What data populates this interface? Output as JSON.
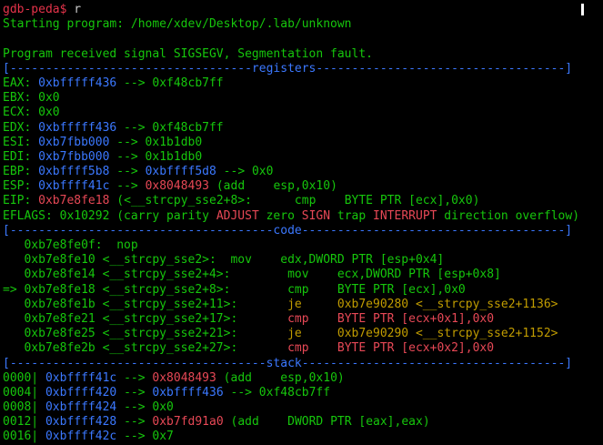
{
  "colors": {
    "default": "#cccccc",
    "prompt": "#e5334a",
    "green": "#16c60c",
    "blue": "#3b78ff",
    "red": "#e74856",
    "yellow": "#c19c00"
  },
  "terminal": {
    "lines": [
      {
        "name": "prompt-line",
        "segments": [
          {
            "text": "gdb-peda$ ",
            "color": "prompt"
          },
          {
            "text": "r",
            "color": "default"
          }
        ]
      },
      {
        "name": "output-line",
        "segments": [
          {
            "text": "Starting program: /home/xdev/Desktop/.lab/unknown",
            "color": "green"
          }
        ]
      },
      {
        "name": "blank-line",
        "segments": []
      },
      {
        "name": "output-line",
        "segments": [
          {
            "text": "Program received signal SIGSEGV, Segmentation fault.",
            "color": "green"
          }
        ]
      },
      {
        "name": "section-header-registers",
        "segments": [
          {
            "text": "[----------------------------------registers-----------------------------------]",
            "color": "blue"
          }
        ]
      },
      {
        "name": "register-eax",
        "segments": [
          {
            "text": "EAX: ",
            "color": "green"
          },
          {
            "text": "0xbfffff436",
            "color": "blue"
          },
          {
            "text": " --> 0xf48cb7ff",
            "color": "green"
          }
        ]
      },
      {
        "name": "register-ebx",
        "segments": [
          {
            "text": "EBX: 0x0",
            "color": "green"
          }
        ]
      },
      {
        "name": "register-ecx",
        "segments": [
          {
            "text": "ECX: 0x0",
            "color": "green"
          }
        ]
      },
      {
        "name": "register-edx",
        "segments": [
          {
            "text": "EDX: ",
            "color": "green"
          },
          {
            "text": "0xbfffff436",
            "color": "blue"
          },
          {
            "text": " --> 0xf48cb7ff",
            "color": "green"
          }
        ]
      },
      {
        "name": "register-esi",
        "segments": [
          {
            "text": "ESI: ",
            "color": "green"
          },
          {
            "text": "0xb7fbb000",
            "color": "blue"
          },
          {
            "text": " --> 0x1b1db0",
            "color": "green"
          }
        ]
      },
      {
        "name": "register-edi",
        "segments": [
          {
            "text": "EDI: ",
            "color": "green"
          },
          {
            "text": "0xb7fbb000",
            "color": "blue"
          },
          {
            "text": " --> 0x1b1db0",
            "color": "green"
          }
        ]
      },
      {
        "name": "register-ebp",
        "segments": [
          {
            "text": "EBP: ",
            "color": "green"
          },
          {
            "text": "0xbffff5b8",
            "color": "blue"
          },
          {
            "text": " --> ",
            "color": "green"
          },
          {
            "text": "0xbffff5d8",
            "color": "blue"
          },
          {
            "text": " --> 0x0",
            "color": "green"
          }
        ]
      },
      {
        "name": "register-esp",
        "segments": [
          {
            "text": "ESP: ",
            "color": "green"
          },
          {
            "text": "0xbffff41c",
            "color": "blue"
          },
          {
            "text": " --> ",
            "color": "green"
          },
          {
            "text": "0x8048493",
            "color": "red"
          },
          {
            "text": " (add    esp,0x10)",
            "color": "green"
          }
        ]
      },
      {
        "name": "register-eip",
        "segments": [
          {
            "text": "EIP: ",
            "color": "green"
          },
          {
            "text": "0xb7e8fe18",
            "color": "red"
          },
          {
            "text": " (<__strcpy_sse2+8>:      cmp    BYTE PTR [ecx],0x0)",
            "color": "green"
          }
        ]
      },
      {
        "name": "register-eflags",
        "segments": [
          {
            "text": "EFLAGS: 0x10292 (carry parity ",
            "color": "green"
          },
          {
            "text": "ADJUST",
            "color": "red"
          },
          {
            "text": " zero ",
            "color": "green"
          },
          {
            "text": "SIGN",
            "color": "red"
          },
          {
            "text": " trap ",
            "color": "green"
          },
          {
            "text": "INTERRUPT",
            "color": "red"
          },
          {
            "text": " direction overflow)",
            "color": "green"
          }
        ]
      },
      {
        "name": "section-header-code",
        "segments": [
          {
            "text": "[-------------------------------------code-------------------------------------]",
            "color": "blue"
          }
        ]
      },
      {
        "name": "code-line",
        "segments": [
          {
            "text": "   0xb7e8fe0f:  nop",
            "color": "green"
          }
        ]
      },
      {
        "name": "code-line",
        "segments": [
          {
            "text": "   0xb7e8fe10 <__strcpy_sse2>:  mov    edx,DWORD PTR [esp+0x4]",
            "color": "green"
          }
        ]
      },
      {
        "name": "code-line",
        "segments": [
          {
            "text": "   0xb7e8fe14 <__strcpy_sse2+4>:        mov    ecx,DWORD PTR [esp+0x8]",
            "color": "green"
          }
        ]
      },
      {
        "name": "code-line-current",
        "segments": [
          {
            "text": "=> 0xb7e8fe18 <__strcpy_sse2+8>:        cmp    BYTE PTR [ecx],0x0",
            "color": "green"
          }
        ]
      },
      {
        "name": "code-line",
        "segments": [
          {
            "text": "   0xb7e8fe1b <__strcpy_sse2+11>:       ",
            "color": "green"
          },
          {
            "text": "je     0xb7e90280 <__strcpy_sse2+1136>",
            "color": "yellow"
          }
        ]
      },
      {
        "name": "code-line",
        "segments": [
          {
            "text": "   0xb7e8fe21 <__strcpy_sse2+17>:       ",
            "color": "green"
          },
          {
            "text": "cmp    BYTE PTR [ecx+0x1],0x0",
            "color": "red"
          }
        ]
      },
      {
        "name": "code-line",
        "segments": [
          {
            "text": "   0xb7e8fe25 <__strcpy_sse2+21>:       ",
            "color": "green"
          },
          {
            "text": "je     0xb7e90290 <__strcpy_sse2+1152>",
            "color": "yellow"
          }
        ]
      },
      {
        "name": "code-line",
        "segments": [
          {
            "text": "   0xb7e8fe2b <__strcpy_sse2+27>:       ",
            "color": "green"
          },
          {
            "text": "cmp    BYTE PTR [ecx+0x2],0x0",
            "color": "red"
          }
        ]
      },
      {
        "name": "section-header-stack",
        "segments": [
          {
            "text": "[------------------------------------stack-------------------------------------]",
            "color": "blue"
          }
        ]
      },
      {
        "name": "stack-line",
        "segments": [
          {
            "text": "0000| ",
            "color": "green"
          },
          {
            "text": "0xbffff41c",
            "color": "blue"
          },
          {
            "text": " --> ",
            "color": "green"
          },
          {
            "text": "0x8048493",
            "color": "red"
          },
          {
            "text": " (add    esp,0x10)",
            "color": "green"
          }
        ]
      },
      {
        "name": "stack-line",
        "segments": [
          {
            "text": "0004| ",
            "color": "green"
          },
          {
            "text": "0xbffff420",
            "color": "blue"
          },
          {
            "text": " --> ",
            "color": "green"
          },
          {
            "text": "0xbffff436",
            "color": "blue"
          },
          {
            "text": " --> 0xf48cb7ff",
            "color": "green"
          }
        ]
      },
      {
        "name": "stack-line",
        "segments": [
          {
            "text": "0008| ",
            "color": "green"
          },
          {
            "text": "0xbffff424",
            "color": "blue"
          },
          {
            "text": " --> 0x0",
            "color": "green"
          }
        ]
      },
      {
        "name": "stack-line",
        "segments": [
          {
            "text": "0012| ",
            "color": "green"
          },
          {
            "text": "0xbffff428",
            "color": "blue"
          },
          {
            "text": " --> ",
            "color": "green"
          },
          {
            "text": "0xb7fd91a0",
            "color": "red"
          },
          {
            "text": " (add    DWORD PTR [eax],eax)",
            "color": "green"
          }
        ]
      },
      {
        "name": "stack-line",
        "segments": [
          {
            "text": "0016| ",
            "color": "green"
          },
          {
            "text": "0xbffff42c",
            "color": "blue"
          },
          {
            "text": " --> 0x7",
            "color": "green"
          }
        ]
      }
    ]
  }
}
